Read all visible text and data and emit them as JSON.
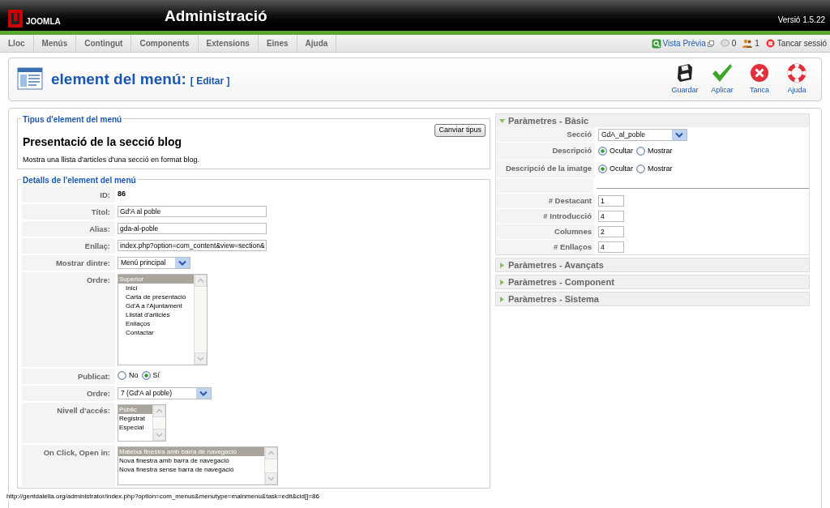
{
  "header": {
    "logo_text": "JOOMLA",
    "title": "Administració",
    "version": "Versió 1.5.22"
  },
  "menu": [
    "Lloc",
    "Menús",
    "Contingut",
    "Components",
    "Extensions",
    "Eines",
    "Ajuda"
  ],
  "status_links": [
    {
      "kind": "preview",
      "label": "Vista Prèvia"
    },
    {
      "kind": "messages",
      "label": "0"
    },
    {
      "kind": "users",
      "label": "1"
    },
    {
      "kind": "logout",
      "label": "Tancar sessió"
    }
  ],
  "toolbar": {
    "title": "element del menú:",
    "subtitle": "[ Editar ]",
    "buttons": [
      {
        "kind": "save",
        "label": "Guardar"
      },
      {
        "kind": "apply",
        "label": "Aplicar"
      },
      {
        "kind": "close",
        "label": "Tanca"
      },
      {
        "kind": "help",
        "label": "Ajuda"
      }
    ]
  },
  "type_section": {
    "legend": "Tipus d'element del menú",
    "heading": "Presentació de la secció blog",
    "description": "Mostra una llista d'articles d'una secció en format blog.",
    "change_button": "Canviar tipus"
  },
  "details": {
    "legend": "Detalls de l'element del menú",
    "rows": [
      {
        "kind": "text",
        "label": "ID:",
        "value": "86"
      },
      {
        "kind": "input",
        "label": "Títol:",
        "value": "Gd'A al poble"
      },
      {
        "kind": "input",
        "label": "Alias:",
        "value": "gda-al-poble"
      },
      {
        "kind": "input",
        "label": "Enllaç:",
        "value": "index.php?option=com_content&view=section&"
      },
      {
        "kind": "select",
        "label": "Mostrar dintre:",
        "value": "Menú principal"
      },
      {
        "kind": "listbox",
        "label": "Ordre:",
        "options": [
          {
            "label": "Superior",
            "selected": true
          },
          {
            "label": "Inici",
            "selected": false
          },
          {
            "label": "Carta de presentació",
            "selected": false
          },
          {
            "label": "Gd'A a l'Ajuntament",
            "selected": false
          },
          {
            "label": "Llistat d'articles",
            "selected": false
          },
          {
            "label": "Enllaços",
            "selected": false
          },
          {
            "label": "Contactar",
            "selected": false
          }
        ]
      },
      {
        "kind": "radio",
        "label": "Publicat:",
        "options": [
          {
            "label": "No",
            "selected": false
          },
          {
            "label": "Sí",
            "selected": true
          }
        ]
      },
      {
        "kind": "select",
        "label": "Ordre:",
        "value": "7 (Gd'A al poble)"
      },
      {
        "kind": "listbox",
        "label": "Nivell d'accés:",
        "options": [
          {
            "label": "Públic",
            "selected": true
          },
          {
            "label": "Registrat",
            "selected": false
          },
          {
            "label": "Especial",
            "selected": false
          }
        ]
      },
      {
        "kind": "listbox",
        "label": "On Click, Open in:",
        "options": [
          {
            "label": "Mateixa finestra amb barra de navegació",
            "selected": true
          },
          {
            "label": "Nova finestra amb barra de navegació",
            "selected": false
          },
          {
            "label": "Nova finestra sense barra de navegació",
            "selected": false
          }
        ]
      }
    ]
  },
  "params": [
    {
      "title": "Paràmetres - Bàsic",
      "expanded": true,
      "rows": [
        {
          "kind": "select",
          "label": "Secció",
          "value": "GdA_al_poble"
        },
        {
          "kind": "radio",
          "label": "Descripció",
          "options": [
            {
              "label": "Ocultar",
              "selected": true
            },
            {
              "label": "Mostrar",
              "selected": false
            }
          ]
        },
        {
          "kind": "radio",
          "label": "Descripció de la imatge",
          "options": [
            {
              "label": "Ocultar",
              "selected": true
            },
            {
              "label": "Mostrar",
              "selected": false
            }
          ]
        },
        {
          "kind": "separator"
        },
        {
          "kind": "input",
          "label": "# Destacant",
          "value": "1"
        },
        {
          "kind": "input",
          "label": "# Introducció",
          "value": "4"
        },
        {
          "kind": "input",
          "label": "Columnes",
          "value": "2"
        },
        {
          "kind": "input",
          "label": "# Enllaços",
          "value": "4"
        }
      ]
    },
    {
      "title": "Paràmetres - Avançats",
      "expanded": false
    },
    {
      "title": "Paràmetres - Component",
      "expanded": false
    },
    {
      "title": "Paràmetres - Sistema",
      "expanded": false
    }
  ],
  "status_bar": "http://gentdalella.org/administrator/index.php?option=com_menus&menutype=mainmenu&task=edit&cid[]=86"
}
